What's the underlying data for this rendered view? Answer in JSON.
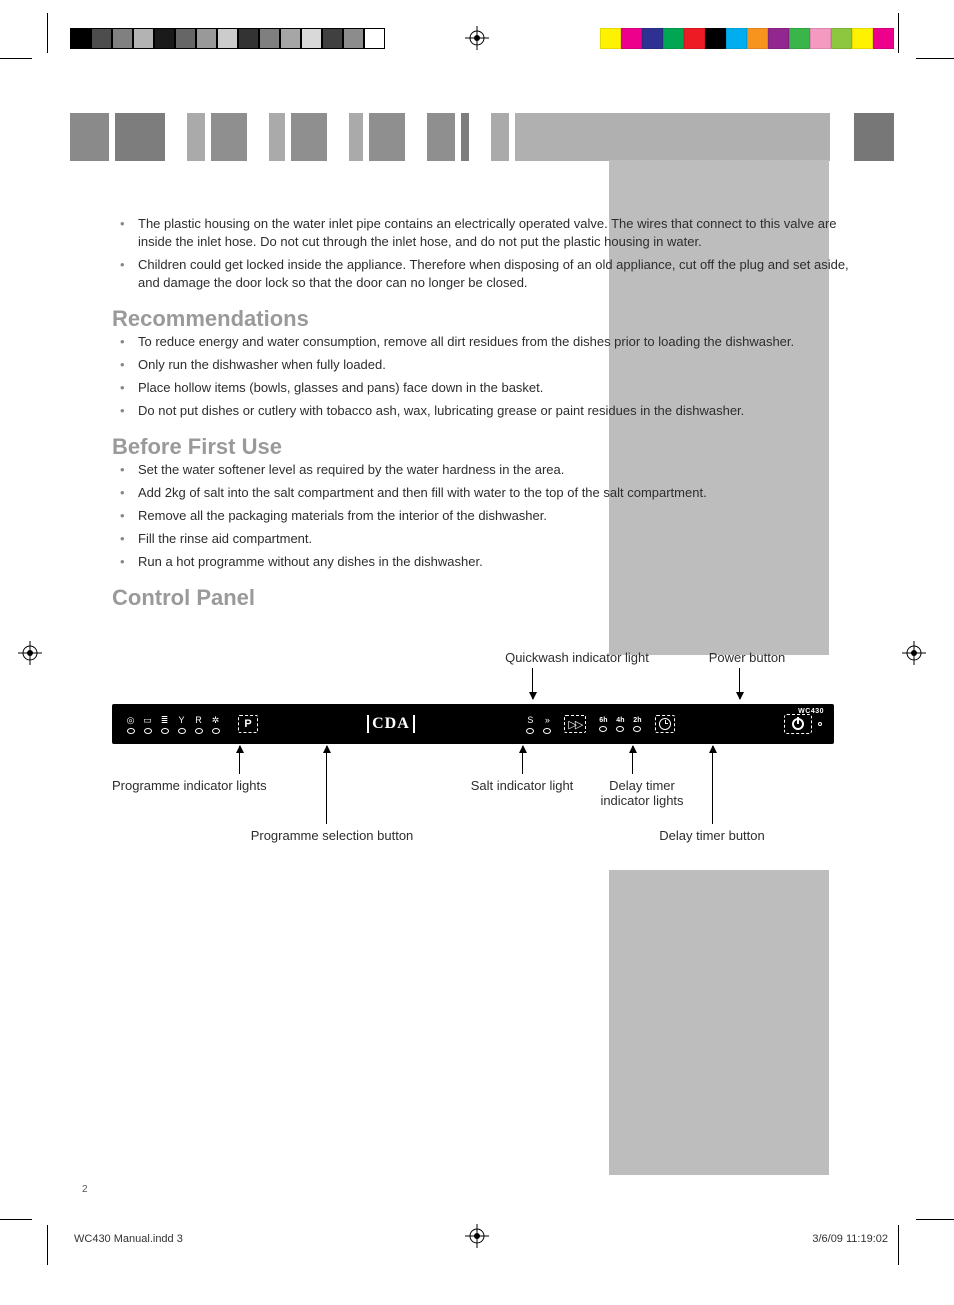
{
  "colorbar1": [
    "#000000",
    "#4d4d4d",
    "#808080",
    "#b3b3b3",
    "#1a1a1a",
    "#666666",
    "#999999",
    "#cccccc",
    "#333333",
    "#7f7f7f",
    "#a6a6a6",
    "#d9d9d9",
    "#404040",
    "#8c8c8c",
    "#ffffff"
  ],
  "colorbar2": [
    "#fff200",
    "#ec008c",
    "#2e3192",
    "#00a651",
    "#ed1c24",
    "#000000",
    "#00aeef",
    "#f7941e",
    "#92278f",
    "#39b54a",
    "#f49ac1",
    "#8dc63f",
    "#fff200",
    "#ec008c"
  ],
  "bullets_top": [
    "The plastic housing on the water inlet pipe contains an electrically operated valve.  The wires that connect to this valve are inside the inlet hose. Do not cut through the inlet hose, and do not put the plastic housing in water.",
    "Children could get locked inside the appliance. Therefore when disposing of an old appliance, cut off the plug and set aside, and damage the door lock so that the door can no longer be closed."
  ],
  "sections": {
    "recommendations": {
      "title": "Recommendations",
      "items": [
        "To reduce energy and water consumption, remove all dirt residues from the dishes prior to loading the dishwasher.",
        "Only run the dishwasher when fully loaded.",
        "Place hollow items (bowls, glasses and pans) face down in the basket.",
        "Do not put dishes or cutlery with tobacco ash, wax, lubricating grease or paint residues in the dishwasher."
      ]
    },
    "before_first_use": {
      "title": "Before First Use",
      "items": [
        "Set the water softener level as required by the water hardness in the area.",
        "Add 2kg of salt into the salt compartment and then fill with water to the top of the salt compartment.",
        "Remove all the packaging materials from the interior of the dishwasher.",
        "Fill the rinse aid compartment.",
        "Run a hot programme without any dishes in the dishwasher."
      ]
    },
    "control_panel": {
      "title": "Control Panel"
    }
  },
  "panel": {
    "brand": "CDA",
    "model": "WC430",
    "prog_button_label": "P",
    "delay_labels": [
      "6h",
      "4h",
      "2h"
    ],
    "callouts": {
      "quickwash": "Quickwash indicator light",
      "power_btn": "Power button",
      "prog_lights": "Programme indicator lights",
      "salt_light": "Salt indicator light",
      "delay_lights": "Delay timer indicator lights",
      "prog_sel_btn": "Programme selection button",
      "delay_btn": "Delay timer button"
    }
  },
  "page_number": "2",
  "footer": {
    "file": "WC430 Manual.indd   3",
    "datetime": "3/6/09   11:19:02"
  }
}
